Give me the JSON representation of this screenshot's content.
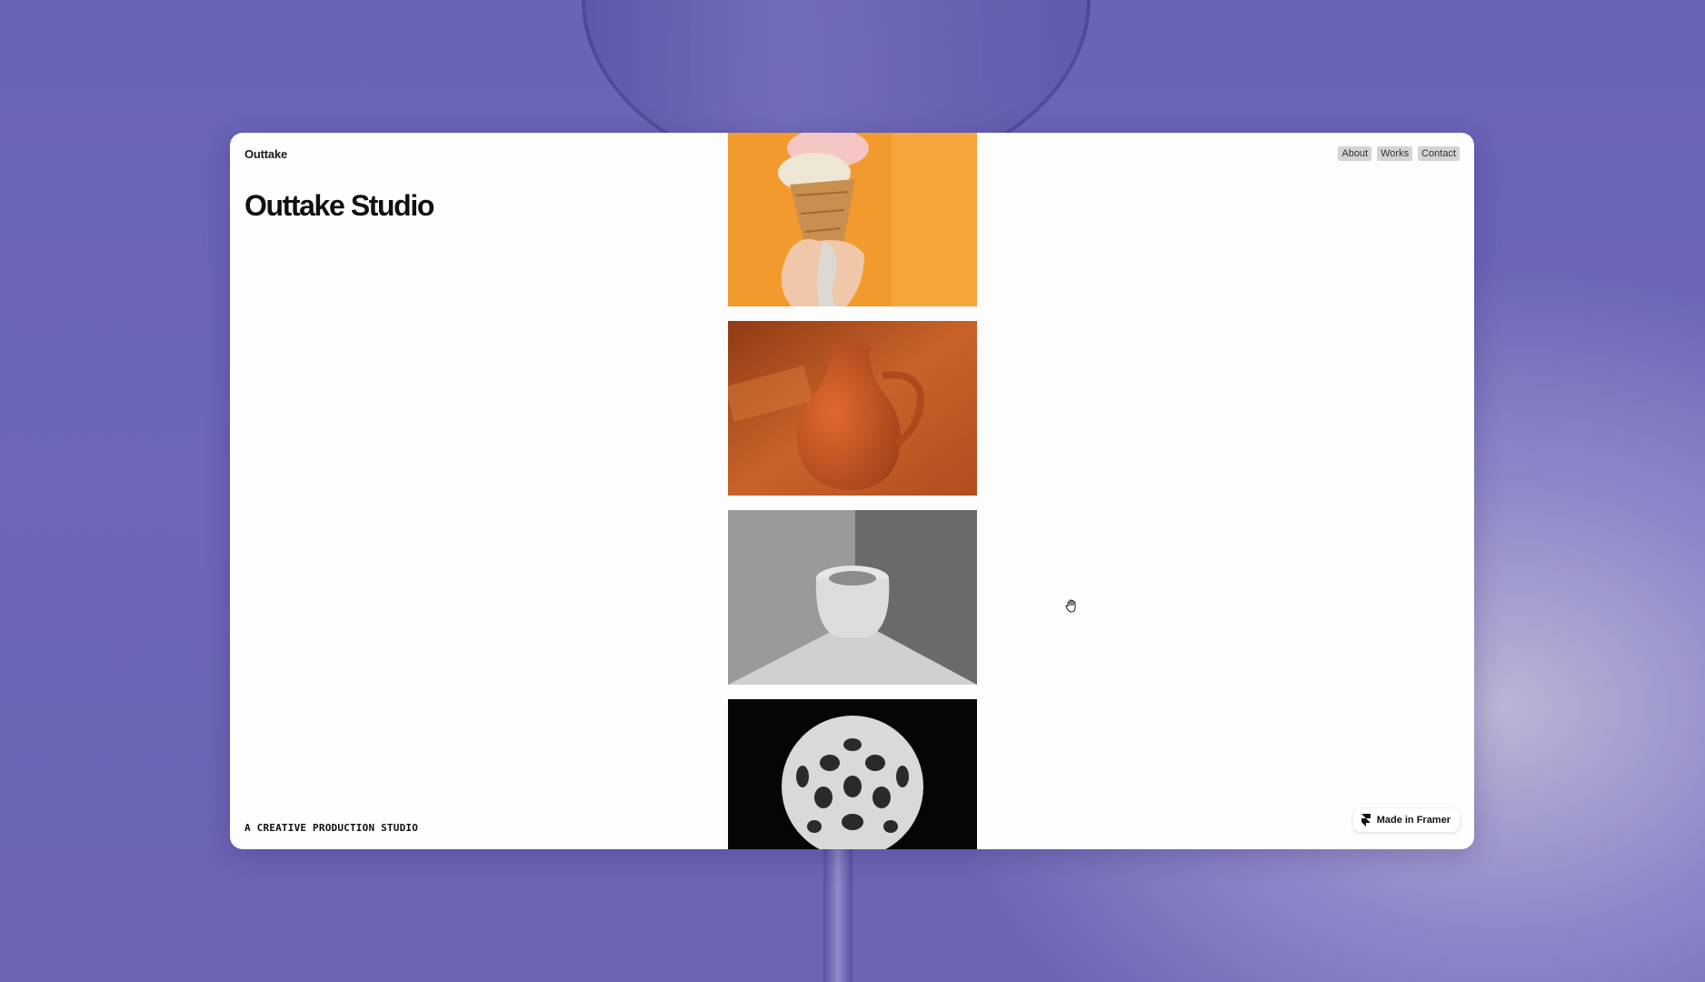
{
  "site": {
    "brand": "Outtake",
    "hero_title": "Outtake Studio",
    "tagline": "A CREATIVE PRODUCTION STUDIO"
  },
  "nav": {
    "items": [
      {
        "label": "About"
      },
      {
        "label": "Works"
      },
      {
        "label": "Contact"
      }
    ]
  },
  "gallery": {
    "images": [
      {
        "name": "ice-cream-cone-photo",
        "bg": "#f19a2e"
      },
      {
        "name": "terracotta-jug-photo",
        "bg": "#c45a22"
      },
      {
        "name": "white-vase-photo",
        "bg": "#8a8a8a"
      },
      {
        "name": "lattice-sphere-photo",
        "bg": "#050505"
      }
    ]
  },
  "badge": {
    "label": "Made in Framer",
    "icon": "framer-logo-icon"
  },
  "cursor": {
    "icon": "hand-cursor-icon"
  }
}
